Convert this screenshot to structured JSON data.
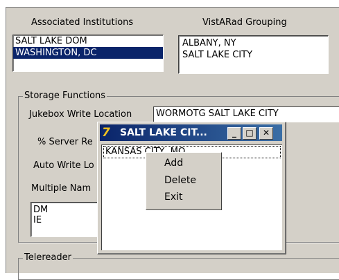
{
  "headers": {
    "associated_institutions": "Associated Institutions",
    "vistarad_grouping": "VistARad Grouping"
  },
  "institutions": [
    {
      "label": "SALT LAKE DOM",
      "selected": false
    },
    {
      "label": "WASHINGTON, DC",
      "selected": true
    }
  ],
  "groupings": [
    "ALBANY, NY",
    "SALT LAKE CITY"
  ],
  "storage": {
    "title": "Storage Functions",
    "jukebox_label": "Jukebox Write Location",
    "jukebox_value": "WORMOTG   SALT LAKE CITY",
    "server_label": "% Server Re",
    "auto_write_label": "Auto Write Lo",
    "multiple_names_label": "Multiple Nam",
    "names": [
      "DM",
      "IE"
    ]
  },
  "teleradiology": {
    "title": "Telereader"
  },
  "popup": {
    "title": "SALT LAKE CIT...",
    "list_items": [
      "KANSAS CITY, MO"
    ],
    "min_label": "_",
    "max_label": "□",
    "close_label": "✕"
  },
  "context_menu": {
    "items": [
      "Add",
      "Delete",
      "Exit"
    ]
  },
  "colors": {
    "selection": "#0a246a",
    "face": "#d4d0c8"
  }
}
